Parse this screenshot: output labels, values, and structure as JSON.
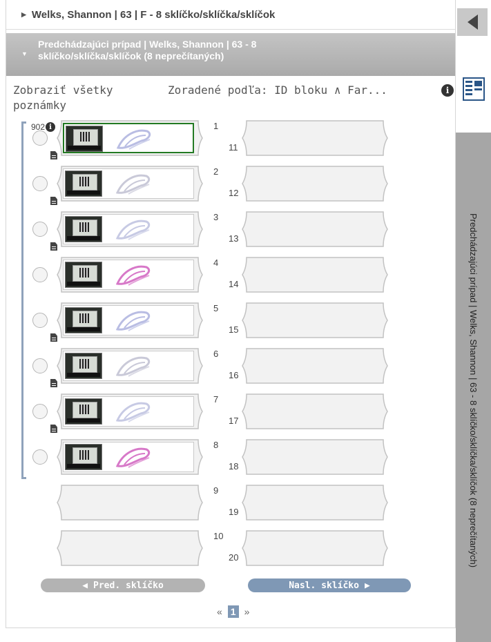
{
  "case_header": {
    "title": "Welks, Shannon | 63 | F - 8 sklíčko/sklíčka/sklíčok"
  },
  "previous_case": {
    "line1": "Predchádzajúci prípad | Welks, Shannon | 63 - 8",
    "line2": "sklíčko/sklíčka/sklíčok (8 neprečítaných)"
  },
  "toolbar": {
    "show_notes_line1": "Zobraziť všetky",
    "show_notes_line2": "poznámky",
    "sort_label": "Zoradené podľa: ID bloku ∧ Far..."
  },
  "side_tab": {
    "label": "Predchádzajúci prípad | Welks, Shannon | 63 - 8 sklíčko/sklíčka/sklíčok (8 neprečítaných)"
  },
  "block": {
    "id": "902"
  },
  "slides": [
    {
      "num": "1",
      "stain": "#b9bde3",
      "selected": true,
      "note": true
    },
    {
      "num": "2",
      "stain": "#c9c9d8",
      "selected": false,
      "note": true
    },
    {
      "num": "3",
      "stain": "#c7cae4",
      "selected": false,
      "note": true
    },
    {
      "num": "4",
      "stain": "#d778c8",
      "selected": false,
      "note": false
    },
    {
      "num": "5",
      "stain": "#b9bde3",
      "selected": false,
      "note": true
    },
    {
      "num": "6",
      "stain": "#c9c9d8",
      "selected": false,
      "note": true
    },
    {
      "num": "7",
      "stain": "#c7cae4",
      "selected": false,
      "note": true
    },
    {
      "num": "8",
      "stain": "#d778c8",
      "selected": false,
      "note": false
    }
  ],
  "empty_left_slots": [
    "9",
    "10"
  ],
  "right_slots": [
    "11",
    "12",
    "13",
    "14",
    "15",
    "16",
    "17",
    "18",
    "19",
    "20"
  ],
  "navigation": {
    "prev_label": "Pred. sklíčko",
    "next_label": "Nasl. sklíčko",
    "prev_color": "#b3b3b3",
    "next_color": "#7f98b5"
  },
  "pager": {
    "first": "«",
    "current": "1",
    "last": "»"
  },
  "colors": {
    "selected_border": "#237a23",
    "bracket": "#8fa2bb"
  }
}
